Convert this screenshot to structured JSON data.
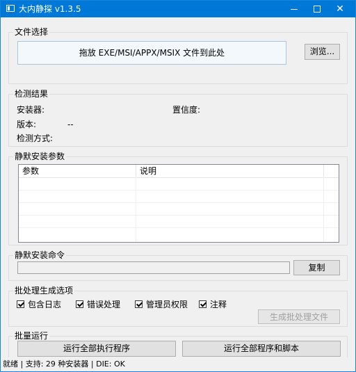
{
  "window": {
    "title": "大内静探 v1.3.5"
  },
  "file_section": {
    "legend": "文件选择",
    "dropzone_text": "拖放 EXE/MSI/APPX/MSIX 文件到此处",
    "browse_label": "浏览..."
  },
  "detect_section": {
    "legend": "检测结果",
    "installer_label": "安装器:",
    "confidence_label": "置信度:",
    "version_label": "版本:",
    "version_value": "--",
    "method_label": "检测方式:"
  },
  "params_section": {
    "legend": "静默安装参数",
    "columns": [
      "参数",
      "说明"
    ]
  },
  "command_section": {
    "legend": "静默安装命令",
    "copy_label": "复制"
  },
  "batch_options": {
    "legend": "批处理生成选项",
    "options": [
      {
        "label": "包含日志",
        "checked": true
      },
      {
        "label": "错误处理",
        "checked": true
      },
      {
        "label": "管理员权限",
        "checked": true
      },
      {
        "label": "注释",
        "checked": true
      }
    ],
    "generate_label": "生成批处理文件"
  },
  "batch_run": {
    "legend": "批量运行",
    "run_exe_label": "运行全部执行程序",
    "run_all_label": "运行全部程序和脚本"
  },
  "status": {
    "text": "就绪 | 支持: 29 种安装器 | DIE: OK"
  }
}
